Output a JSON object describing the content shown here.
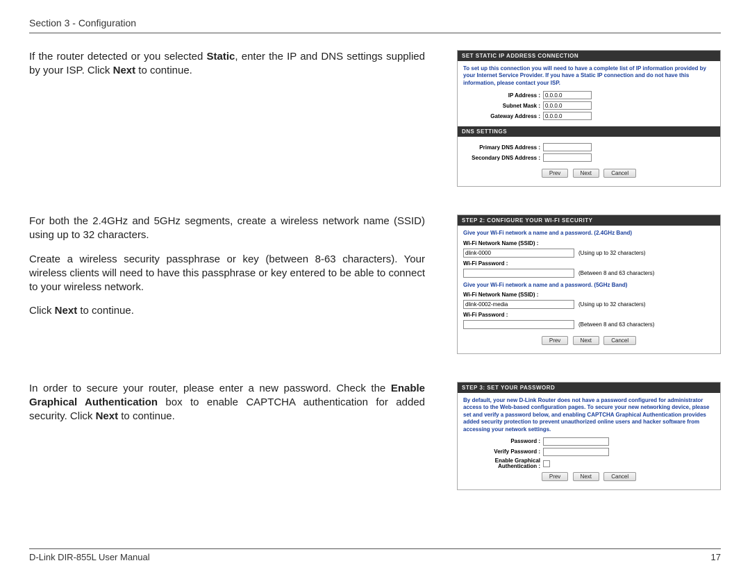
{
  "header": {
    "section": "Section 3 - Configuration"
  },
  "footer": {
    "manual": "D-Link DIR-855L User Manual",
    "page": "17"
  },
  "block1": {
    "para1_a": "If the router detected or you selected ",
    "para1_b": "Static",
    "para1_c": ", enter the IP and DNS settings supplied by your ISP. Click ",
    "para1_d": "Next",
    "para1_e": " to continue.",
    "shot": {
      "title": "SET STATIC IP ADDRESS CONNECTION",
      "note": "To set up this connection you will need to have a complete list of IP information provided by your Internet Service Provider. If you have a Static IP connection and do not have this information, please contact your ISP.",
      "fields": {
        "ip_label": "IP Address :",
        "ip_val": "0.0.0.0",
        "mask_label": "Subnet Mask :",
        "mask_val": "0.0.0.0",
        "gw_label": "Gateway Address :",
        "gw_val": "0.0.0.0"
      },
      "dns_title": "DNS SETTINGS",
      "dns": {
        "p_label": "Primary DNS Address :",
        "p_val": "",
        "s_label": "Secondary DNS Address :",
        "s_val": ""
      },
      "buttons": {
        "prev": "Prev",
        "next": "Next",
        "cancel": "Cancel"
      }
    }
  },
  "block2": {
    "para1": "For both the 2.4GHz and 5GHz segments, create a wireless network name (SSID) using up to 32 characters.",
    "para2": "Create a wireless security passphrase or key (between 8-63 characters). Your wireless clients will need to have this passphrase or key entered to be able to connect to your wireless network.",
    "para3_a": "Click ",
    "para3_b": "Next",
    "para3_c": " to continue.",
    "shot": {
      "title": "STEP 2: CONFIGURE YOUR WI-FI SECURITY",
      "head24": "Give your Wi-Fi network a name and a password. (2.4GHz Band)",
      "ssid_label": "Wi-Fi Network Name (SSID) :",
      "ssid24_val": "dlink-0000",
      "ssid_hint": "(Using up to 32 characters)",
      "pw_label": "Wi-Fi Password :",
      "pw_hint": "(Between 8 and 63 characters)",
      "head5": "Give your Wi-Fi network a name and a password. (5GHz Band)",
      "ssid5_val": "dlink-0002-media",
      "buttons": {
        "prev": "Prev",
        "next": "Next",
        "cancel": "Cancel"
      }
    }
  },
  "block3": {
    "para1_a": "In order to secure your router, please enter a new password. Check the ",
    "para1_b": "Enable Graphical Authentication",
    "para1_c": " box to enable CAPTCHA authentication for added security. Click ",
    "para1_d": "Next",
    "para1_e": " to continue.",
    "shot": {
      "title": "STEP 3: SET YOUR PASSWORD",
      "note": "By default, your new D-Link Router does not have a password configured for administrator access to the Web-based configuration pages. To secure your new networking device, please set and verify a password below, and enabling CAPTCHA Graphical Authentication provides added security protection to prevent unauthorized online users and hacker software from accessing your network settings.",
      "pw_label": "Password :",
      "vpw_label": "Verify Password :",
      "ega_label1": "Enable Graphical",
      "ega_label2": "Authentication :",
      "buttons": {
        "prev": "Prev",
        "next": "Next",
        "cancel": "Cancel"
      }
    }
  }
}
